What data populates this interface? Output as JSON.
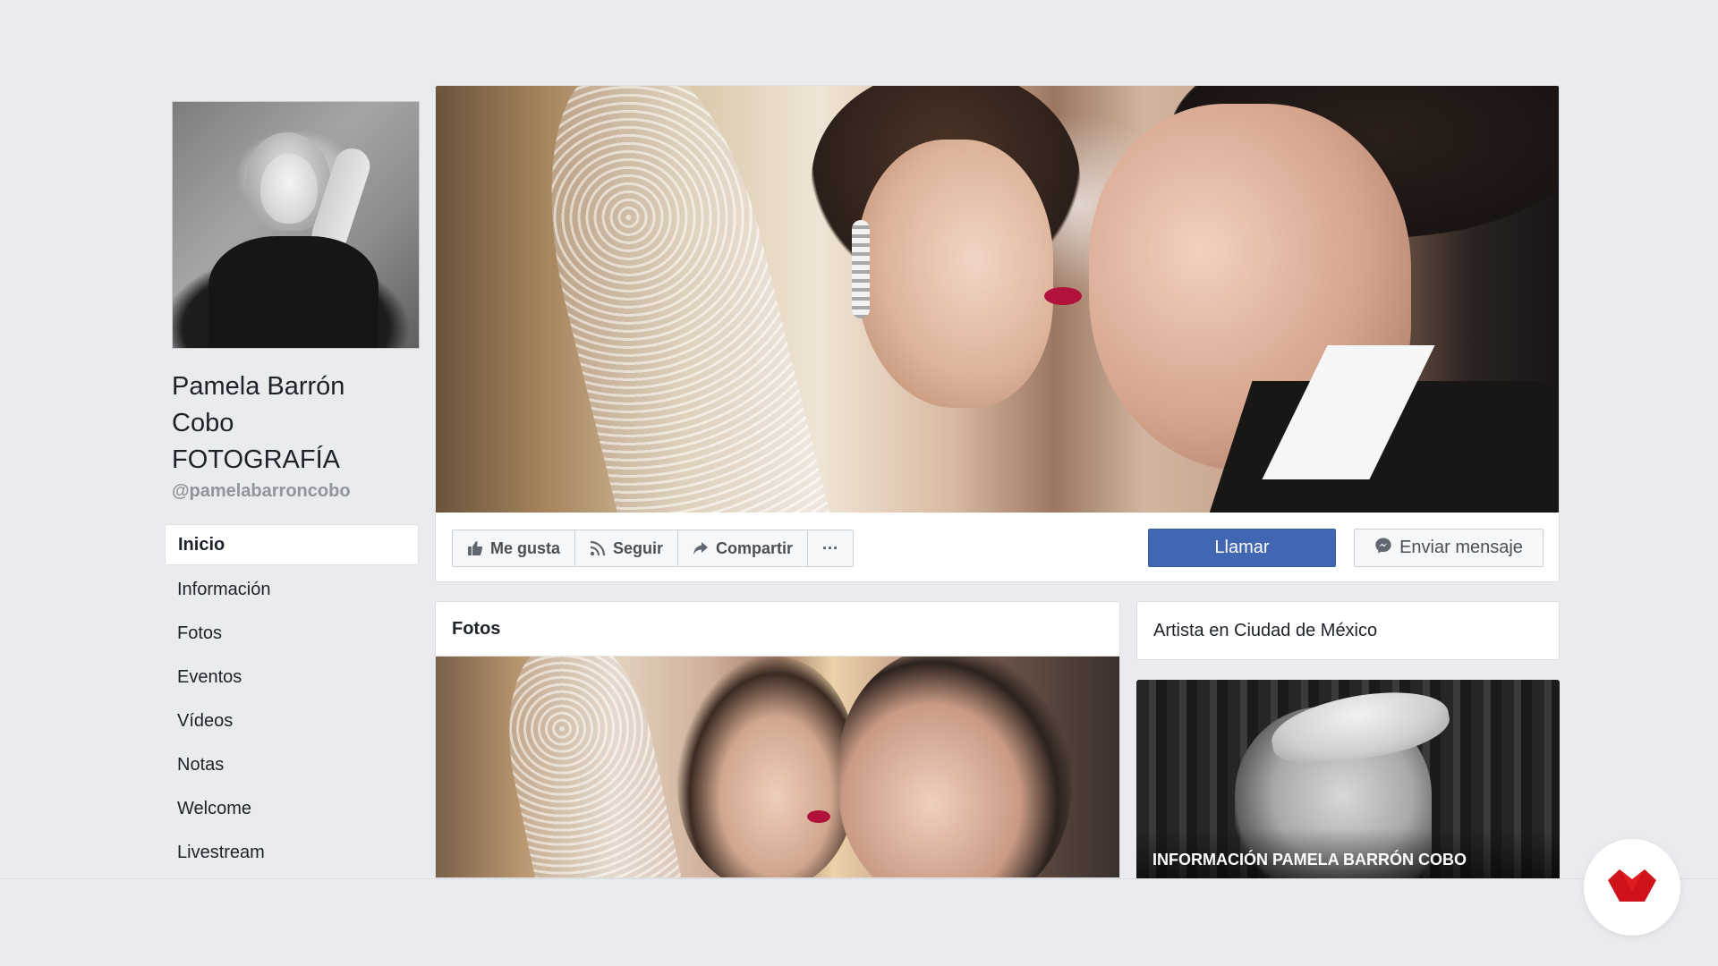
{
  "profile": {
    "name_line1": "Pamela Barrón",
    "name_line2": "Cobo",
    "name_line3": "FOTOGRAFÍA",
    "handle": "@pamelabarroncobo"
  },
  "sidebar": {
    "items": [
      {
        "label": "Inicio",
        "active": true
      },
      {
        "label": "Información"
      },
      {
        "label": "Fotos"
      },
      {
        "label": "Eventos"
      },
      {
        "label": "Vídeos"
      },
      {
        "label": "Notas"
      },
      {
        "label": "Welcome"
      },
      {
        "label": "Livestream"
      }
    ]
  },
  "actions": {
    "like_label": "Me gusta",
    "follow_label": "Seguir",
    "share_label": "Compartir",
    "more_label": "···",
    "call_label": "Llamar",
    "message_label": "Enviar mensaje"
  },
  "photos": {
    "title": "Fotos"
  },
  "about": {
    "category": "Artista en Ciudad de México"
  },
  "info_card": {
    "caption": "INFORMACIÓN PAMELA BARRÓN COBO"
  },
  "colors": {
    "background": "#e9ebee",
    "primary_button": "#4267b2",
    "logo_red": "#d0121b"
  },
  "icons": {
    "like": "thumbs-up-icon",
    "follow": "rss-icon",
    "share": "share-arrow-icon",
    "more": "more-dots-icon",
    "message": "messenger-icon",
    "logo": "brand-logo-icon"
  }
}
